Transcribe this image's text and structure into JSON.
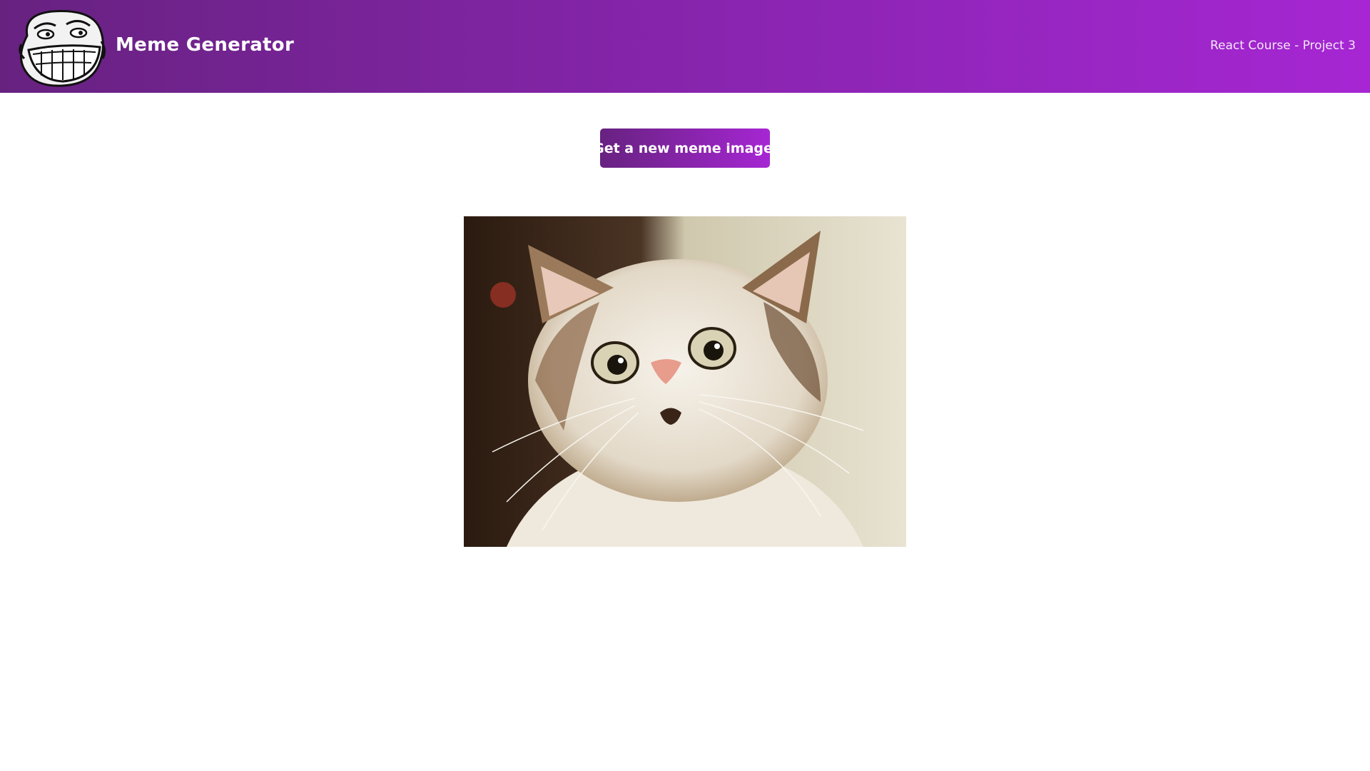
{
  "header": {
    "title": "Meme Generator",
    "subtitle": "React Course - Project 3",
    "logo_icon": "troll-face-icon"
  },
  "form": {
    "button_label": "Get a new meme image",
    "button_icon": "image-file-icon"
  },
  "meme": {
    "image_description_icon": "surprised-cat-image"
  },
  "colors": {
    "gradient_start": "#672280",
    "gradient_end": "#a626d3",
    "background": "#ffffff"
  }
}
